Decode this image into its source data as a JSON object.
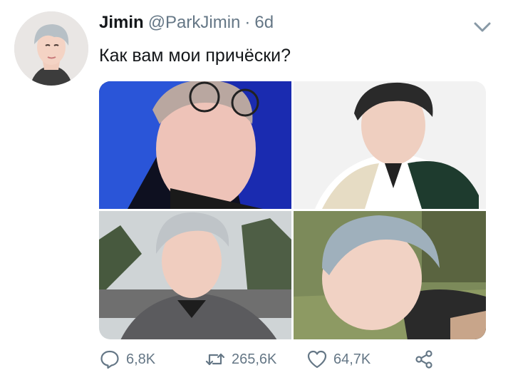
{
  "tweet": {
    "author_name": "Jimin",
    "handle": "@ParkJimin",
    "separator": "·",
    "time": "6d",
    "text": "Как вам мои причёски?"
  },
  "icons": {
    "reply": "reply-icon",
    "retweet": "retweet-icon",
    "like": "heart-icon",
    "share": "share-icon",
    "menu": "chevron-down-icon"
  },
  "actions": {
    "replies": "6,8K",
    "retweets": "265,6K",
    "likes": "64,7K"
  },
  "colors": {
    "muted": "#657786",
    "text": "#14171a"
  }
}
